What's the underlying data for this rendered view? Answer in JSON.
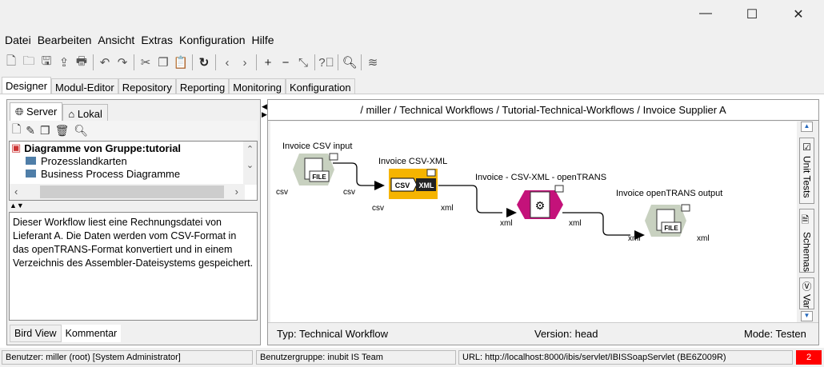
{
  "window": {
    "minimize": "—",
    "maximize": "☐",
    "close": "✕"
  },
  "menu": [
    "Datei",
    "Bearbeiten",
    "Ansicht",
    "Extras",
    "Konfiguration",
    "Hilfe"
  ],
  "toolbar": [
    "new-icon",
    "open-icon",
    "save-icon",
    "export-icon",
    "print-icon",
    "undo-icon",
    "redo-icon",
    "cut-icon",
    "copy-icon",
    "paste-icon",
    "refresh-icon",
    "back-icon",
    "forward-icon",
    "zoom-in-icon",
    "zoom-out-icon",
    "fit-icon",
    "help-icon",
    "search-icon",
    "wifi-icon"
  ],
  "tabs": [
    "Designer",
    "Modul-Editor",
    "Repository",
    "Reporting",
    "Monitoring",
    "Konfiguration"
  ],
  "left": {
    "tabs": [
      "Server",
      "Lokal"
    ],
    "tree_root": "Diagramme von Gruppe:tutorial",
    "tree_items": [
      "Prozesslandkarten",
      "Business Process Diagramme"
    ],
    "comment": "Dieser Workflow liest eine Rechnungsdatei von Lieferant A. Die Daten werden vom CSV-Format in das openTRANS-Format konvertiert und in einem Verzeichnis des Assembler-Dateisystems gespeichert.",
    "bottom_tabs": [
      "Bird View",
      "Kommentar"
    ]
  },
  "breadcrumb": "/ miller / Technical Workflows / Tutorial-Technical-Workflows / Invoice Supplier A",
  "diagram": {
    "nodes": [
      {
        "label": "Invoice CSV input",
        "in": "csv",
        "out": "csv",
        "icon": "FILE"
      },
      {
        "label": "Invoice CSV-XML",
        "in": "csv",
        "out": "xml",
        "icon_left": "CSV",
        "icon_right": "XML"
      },
      {
        "label": "Invoice - CSV-XML - openTRANS",
        "in": "xml",
        "out": "xml"
      },
      {
        "label": "Invoice openTRANS output",
        "in": "xml",
        "out": "xml",
        "icon": "FILE"
      }
    ],
    "colors": {
      "file": "#c8d1c0",
      "converter": "#f5b400",
      "mapper": "#c4127a"
    }
  },
  "side_tabs": [
    "Unit Tests",
    "Schemas",
    "Var"
  ],
  "footer": {
    "type": "Typ: Technical Workflow",
    "version": "Version: head",
    "mode": "Mode: Testen"
  },
  "statusbar": {
    "user": "Benutzer: miller (root) [System Administrator]",
    "group": "Benutzergruppe: inubit IS Team",
    "url": "URL: http://localhost:8000/ibis/servlet/IBISSoapServlet (BE6Z009R)",
    "count": "2"
  }
}
